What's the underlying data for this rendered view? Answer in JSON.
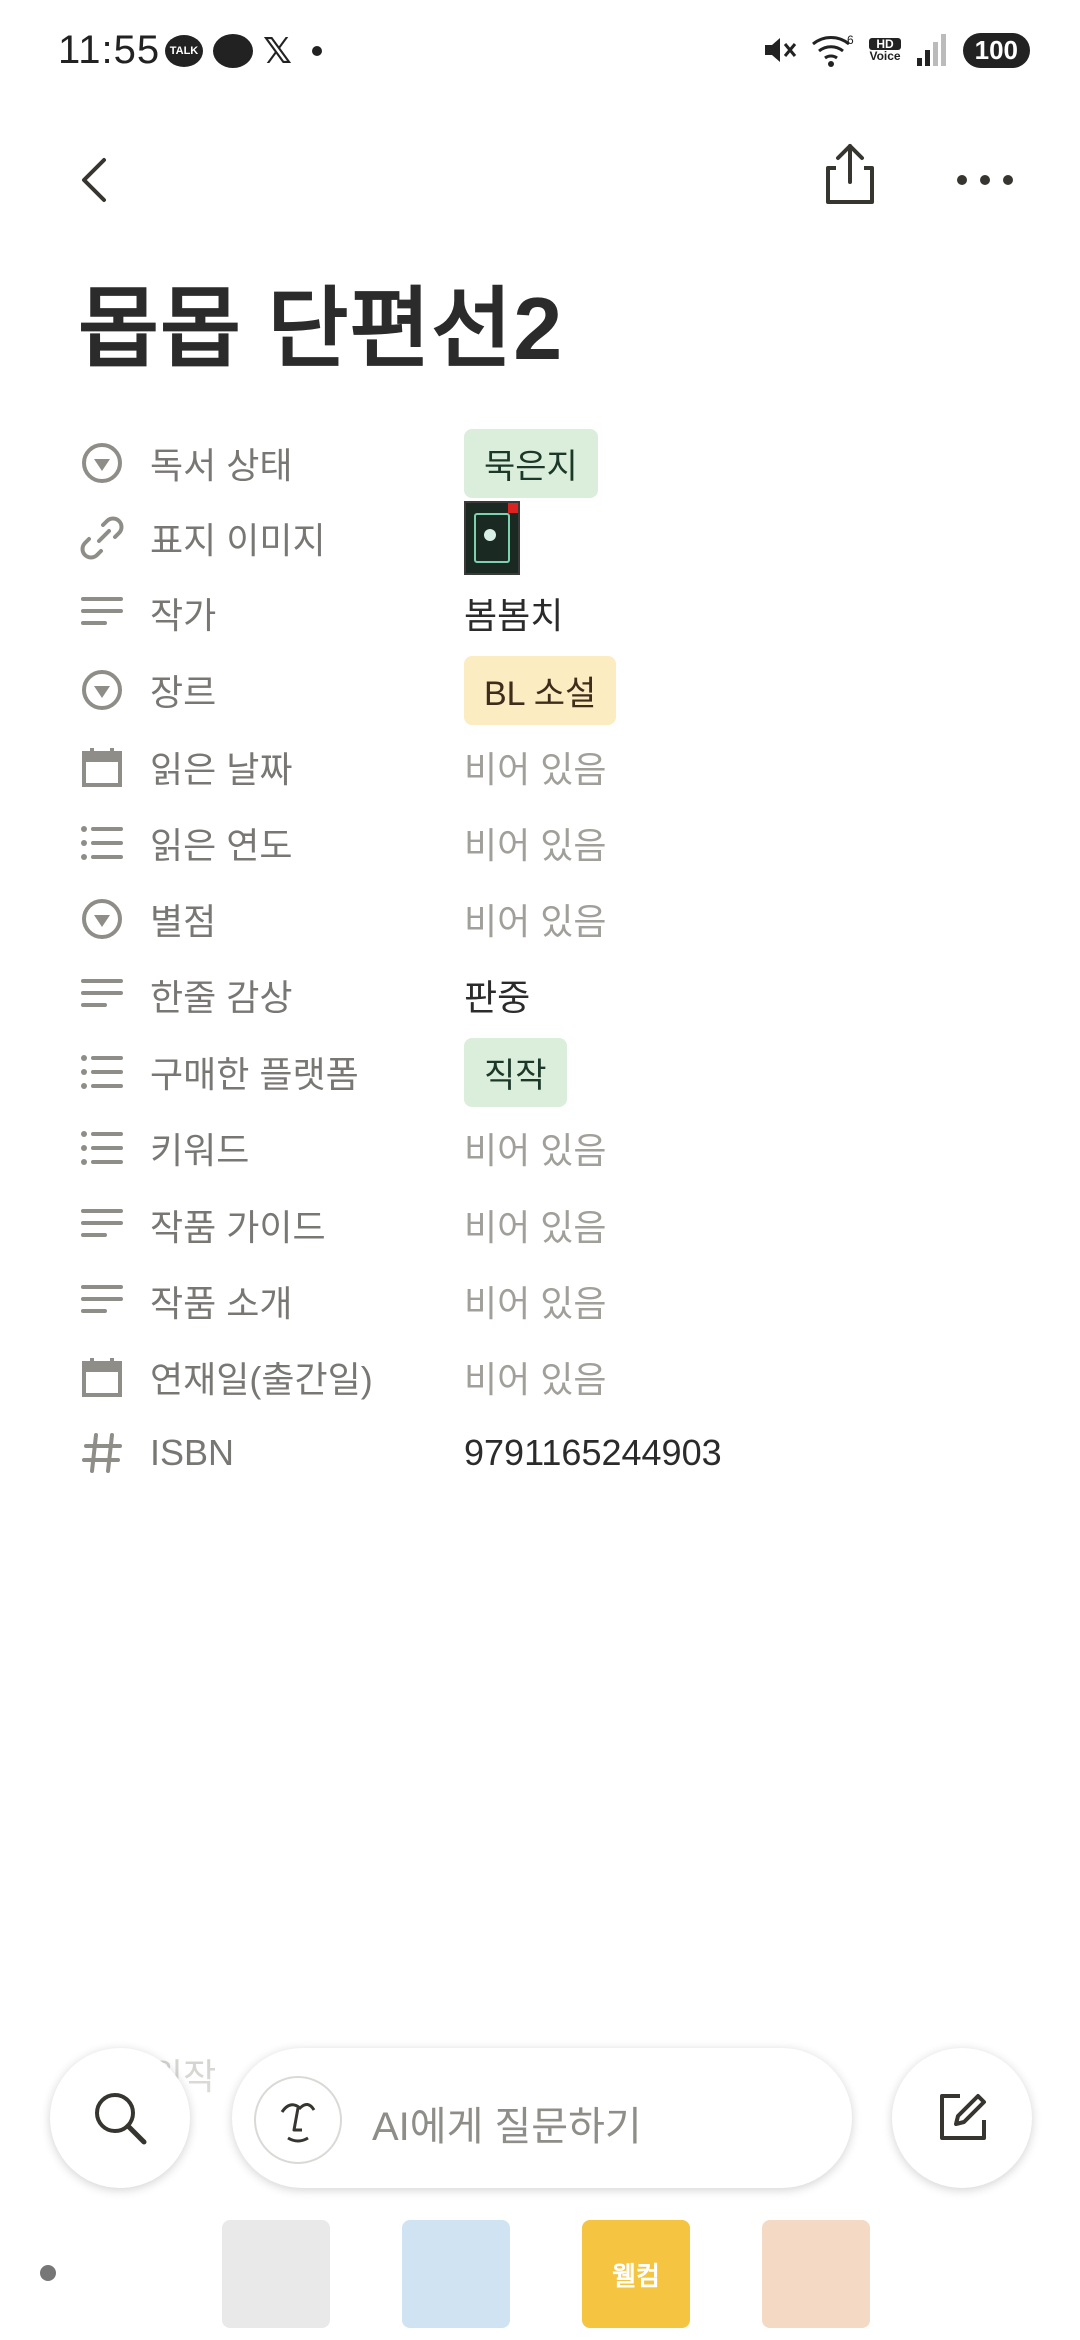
{
  "status_bar": {
    "time": "11:55",
    "talk_badge": "TALK",
    "x_glyph": "𝕏",
    "hd_top": "HD",
    "hd_bottom": "Voice",
    "wifi_badge": "6",
    "battery": "100"
  },
  "header": {
    "title": "몹몹 단편선2",
    "back_icon": "back-arrow-icon",
    "share_icon": "share-icon",
    "more_icon": "more-horizontal-icon"
  },
  "properties": [
    {
      "icon": "select-icon",
      "name": "독서 상태",
      "value": "묵은지",
      "type": "tag",
      "tag_bg": "#dbeddb",
      "tag_color": "#1c3829"
    },
    {
      "icon": "link-icon",
      "name": "표지 이미지",
      "value": "",
      "type": "image"
    },
    {
      "icon": "text-icon",
      "name": "작가",
      "value": "봄봄치",
      "type": "text"
    },
    {
      "icon": "select-icon",
      "name": "장르",
      "value": "BL 소설",
      "type": "tag",
      "tag_bg": "#fbecc2",
      "tag_color": "#402c1b"
    },
    {
      "icon": "calendar-icon",
      "name": "읽은 날짜",
      "value": "비어 있음",
      "type": "empty"
    },
    {
      "icon": "list-icon",
      "name": "읽은 연도",
      "value": "비어 있음",
      "type": "empty"
    },
    {
      "icon": "select-icon",
      "name": "별점",
      "value": "비어 있음",
      "type": "empty"
    },
    {
      "icon": "text-icon",
      "name": "한줄 감상",
      "value": "판중",
      "type": "text"
    },
    {
      "icon": "list-icon",
      "name": "구매한 플랫폼",
      "value": "직작",
      "type": "tag",
      "tag_bg": "#dbeddb",
      "tag_color": "#1c3829"
    },
    {
      "icon": "list-icon",
      "name": "키워드",
      "value": "비어 있음",
      "type": "empty"
    },
    {
      "icon": "text-icon",
      "name": "작품 가이드",
      "value": "비어 있음",
      "type": "empty"
    },
    {
      "icon": "text-icon",
      "name": "작품 소개",
      "value": "비어 있음",
      "type": "empty"
    },
    {
      "icon": "calendar-icon",
      "name": "연재일(출간일)",
      "value": "비어 있음",
      "type": "empty"
    },
    {
      "icon": "hash-icon",
      "name": "ISBN",
      "value": "9791165244903",
      "type": "text"
    }
  ],
  "partial_row": {
    "name": "원작"
  },
  "bottom_bar": {
    "search_icon": "search-icon",
    "ai_icon": "ai-face-icon",
    "ai_placeholder": "AI에게 질문하기",
    "edit_icon": "compose-icon"
  },
  "sticker_strip": {
    "stickers": [
      {
        "label": "",
        "color": "#e9e9e9"
      },
      {
        "label": "",
        "color": "#cfe3f2"
      },
      {
        "label": "웰컴",
        "color": "#f5c542"
      },
      {
        "label": "",
        "color": "#f4d9c4"
      }
    ]
  }
}
